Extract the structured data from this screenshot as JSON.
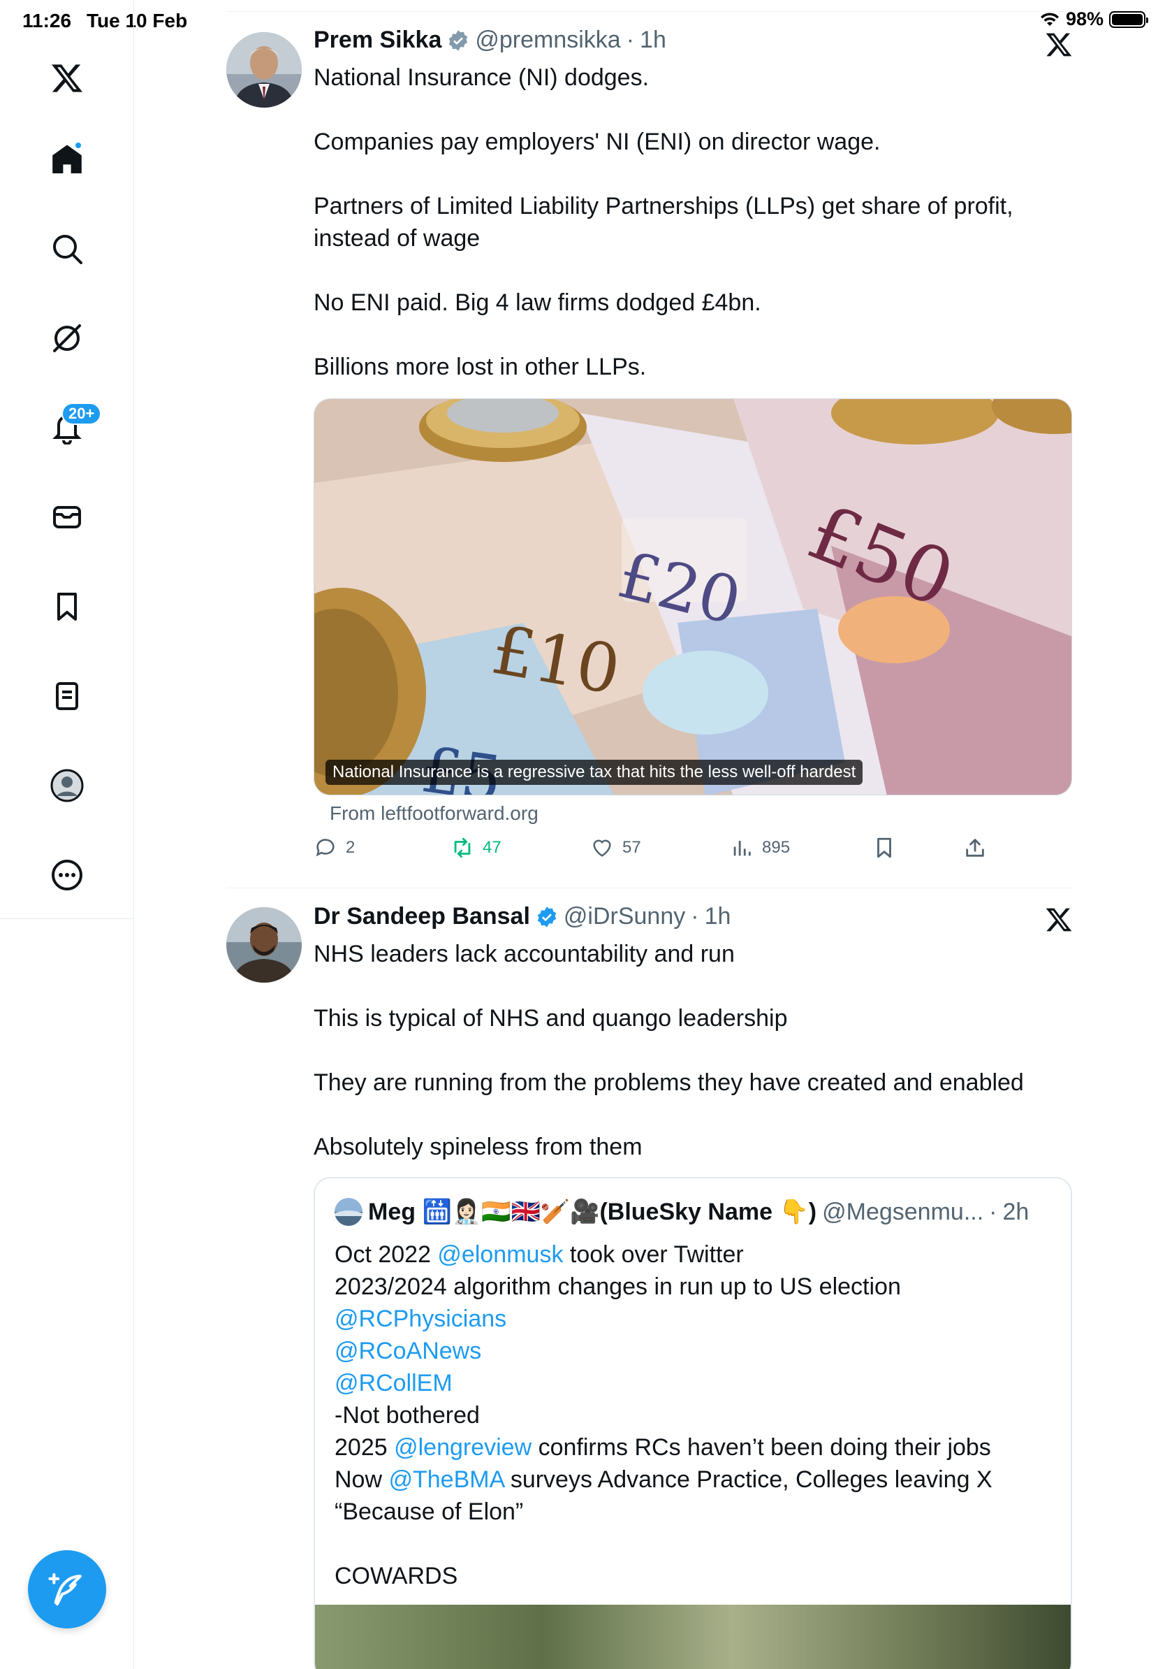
{
  "status_bar": {
    "time": "11:26",
    "date": "Tue 10 Feb",
    "battery": "98%"
  },
  "sidebar": {
    "notification_badge": "20+",
    "items": [
      "x-logo",
      "home",
      "search",
      "grok",
      "notifications",
      "messages",
      "bookmarks",
      "lists",
      "profile",
      "more"
    ]
  },
  "tweets": [
    {
      "name": "Prem Sikka",
      "handle": "@premnsikka",
      "time": "1h",
      "paragraphs": [
        "National Insurance (NI) dodges.",
        "Companies pay employers' NI (ENI) on director wage.",
        "Partners of Limited Liability Partnerships (LLPs) get share of profit, instead of wage",
        "No ENI paid. Big 4 law firms dodged £4bn.",
        "Billions more lost in other LLPs."
      ],
      "card": {
        "caption": "National Insurance is a regressive tax that hits the less well-off hardest",
        "source": "From leftfootforward.org",
        "note_50": "£50",
        "note_20": "£20",
        "note_10": "£10",
        "note_5": "£5"
      },
      "stats": {
        "replies": "2",
        "reposts": "47",
        "likes": "57",
        "views": "895"
      }
    },
    {
      "name": "Dr Sandeep Bansal",
      "handle": "@iDrSunny",
      "time": "1h",
      "paragraphs": [
        "NHS leaders lack accountability and run",
        "This is typical of NHS and quango leadership",
        "They are running from the problems they have created and enabled",
        "Absolutely spineless from them"
      ],
      "quote": {
        "name": "Meg 🛗👩🏻‍⚕️🇮🇳🇬🇧🏏🎥(BlueSky Name 👇)",
        "handle": "@Megsenmu...",
        "time": "2h",
        "l1_a": "Oct 2022 ",
        "l1_mention": "@elonmusk",
        "l1_b": " took over Twitter",
        "l2": "2023/2024 algorithm changes in run up to US election",
        "l3": "@RCPhysicians",
        "l4": "@RCoANews",
        "l5": "@RCollEM",
        "l6": "-Not bothered",
        "l7_a": "2025 ",
        "l7_mention": "@lengreview",
        "l7_b": " confirms RCs haven’t been doing their jobs",
        "l8_a": "Now ",
        "l8_mention": "@TheBMA",
        "l8_b": " surveys Advance Practice, Colleges leaving X",
        "l9": "“Because of Elon”",
        "l10": "COWARDS"
      }
    }
  ],
  "colors": {
    "accent": "#1d9bf0",
    "repost_active": "#00ba7c",
    "secondary_text": "#536471"
  }
}
